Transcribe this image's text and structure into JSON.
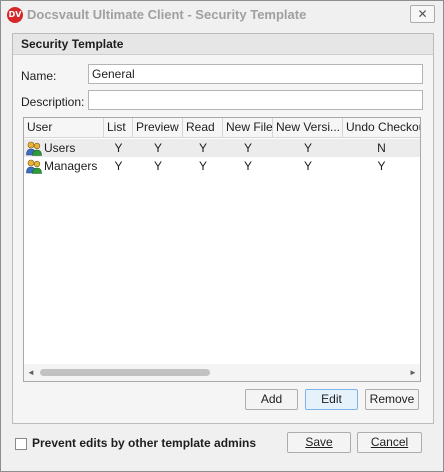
{
  "window": {
    "title": "Docsvault Ultimate Client - Security Template",
    "logo_text": "DV",
    "close_glyph": "✕"
  },
  "panel": {
    "header": "Security Template",
    "name_label": "Name:",
    "name_value": "General",
    "description_label": "Description:",
    "description_value": ""
  },
  "grid": {
    "columns": [
      "User",
      "List",
      "Preview",
      "Read",
      "New File",
      "New Versi...",
      "Undo Checkout"
    ],
    "rows": [
      {
        "user": "Users",
        "values": [
          "Y",
          "Y",
          "Y",
          "Y",
          "Y",
          "N"
        ]
      },
      {
        "user": "Managers",
        "values": [
          "Y",
          "Y",
          "Y",
          "Y",
          "Y",
          "Y"
        ]
      }
    ],
    "user_icon": "users-group-icon",
    "scroll_left": "◄",
    "scroll_right": "►"
  },
  "buttons": {
    "add": "Add",
    "edit": "Edit",
    "remove": "Remove",
    "save": "Save",
    "cancel": "Cancel"
  },
  "footer": {
    "prevent_edits_label": "Prevent edits by other template admins",
    "prevent_edits_checked": false
  },
  "colors": {
    "logo": "#d62828",
    "selected_row": "#ececec",
    "active_button": "#e5f1fb"
  }
}
